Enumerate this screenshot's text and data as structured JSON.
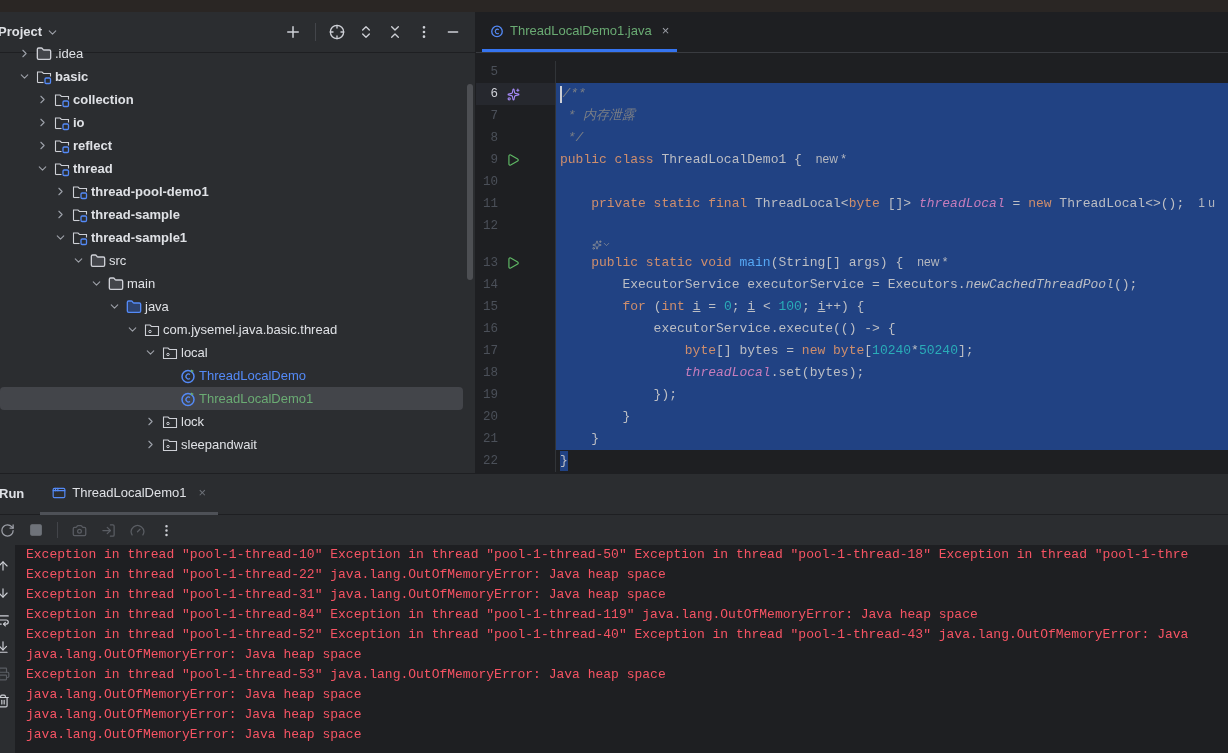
{
  "project_panel": {
    "title": "Project",
    "tree": [
      {
        "label": ".idea",
        "kind": "folder",
        "expanded": false,
        "selected": false
      },
      {
        "label": "basic",
        "kind": "module",
        "expanded": true,
        "selected": false,
        "children": [
          {
            "label": "collection",
            "kind": "module",
            "expanded": false,
            "selected": false
          },
          {
            "label": "io",
            "kind": "module",
            "expanded": false,
            "selected": false
          },
          {
            "label": "reflect",
            "kind": "module",
            "expanded": false,
            "selected": false
          },
          {
            "label": "thread",
            "kind": "module",
            "expanded": true,
            "selected": false,
            "children": [
              {
                "label": "thread-pool-demo1",
                "kind": "module",
                "expanded": false,
                "selected": false
              },
              {
                "label": "thread-sample",
                "kind": "module",
                "expanded": false,
                "selected": false
              },
              {
                "label": "thread-sample1",
                "kind": "module",
                "expanded": true,
                "selected": false,
                "children": [
                  {
                    "label": "src",
                    "kind": "folder",
                    "expanded": true,
                    "selected": false,
                    "children": [
                      {
                        "label": "main",
                        "kind": "folder",
                        "expanded": true,
                        "selected": false,
                        "children": [
                          {
                            "label": "java",
                            "kind": "source",
                            "expanded": true,
                            "selected": false,
                            "children": [
                              {
                                "label": "com.jysemel.java.basic.thread",
                                "kind": "package",
                                "expanded": true,
                                "selected": false,
                                "children": [
                                  {
                                    "label": "local",
                                    "kind": "package",
                                    "expanded": true,
                                    "selected": false,
                                    "children": [
                                      {
                                        "label": "ThreadLocalDemo",
                                        "kind": "class",
                                        "added": false,
                                        "selected": false
                                      },
                                      {
                                        "label": "ThreadLocalDemo1",
                                        "kind": "class",
                                        "added": true,
                                        "selected": true
                                      }
                                    ]
                                  },
                                  {
                                    "label": "lock",
                                    "kind": "package",
                                    "expanded": false,
                                    "selected": false
                                  },
                                  {
                                    "label": "sleepandwait",
                                    "kind": "package",
                                    "expanded": false,
                                    "selected": false
                                  }
                                ]
                              }
                            ]
                          }
                        ]
                      }
                    ]
                  }
                ]
              }
            ]
          }
        ]
      }
    ]
  },
  "editor": {
    "tabs": [
      {
        "label": "ThreadLocalDemo1.java",
        "added": true,
        "selected": true,
        "close": "×"
      }
    ],
    "lines": [
      {
        "kind": "code",
        "number": "5",
        "current": false,
        "selected": false
      },
      {
        "kind": "code",
        "number": "6",
        "current": true,
        "selected": true,
        "gutter": {
          "kind": "badge"
        },
        "tokens": [
          {
            "t": "/**",
            "kind": "comment"
          }
        ]
      },
      {
        "kind": "code",
        "number": "7",
        "current": false,
        "selected": true,
        "tokens": [
          {
            "t": " * 内存泄露",
            "kind": "comment"
          }
        ]
      },
      {
        "kind": "code",
        "number": "8",
        "current": false,
        "selected": true,
        "tokens": [
          {
            "t": " */",
            "kind": "comment"
          }
        ]
      },
      {
        "kind": "code",
        "number": "9",
        "current": false,
        "selected": true,
        "gutter": {
          "kind": "run"
        },
        "tokens": [
          {
            "t": "public class ",
            "kind": "keyword"
          },
          {
            "t": "ThreadLocalDemo1 {",
            "kind": "plain"
          },
          {
            "t": "new *",
            "kind": "hint"
          }
        ]
      },
      {
        "kind": "code",
        "number": "10",
        "current": false,
        "selected": true
      },
      {
        "kind": "code",
        "number": "11",
        "current": false,
        "selected": true,
        "tokens": [
          {
            "t": "    private static final ",
            "kind": "keyword"
          },
          {
            "t": "ThreadLocal<",
            "kind": "plain"
          },
          {
            "t": "byte ",
            "kind": "keyword"
          },
          {
            "t": "[]> ",
            "kind": "plain"
          },
          {
            "t": "threadLocal",
            "kind": "field"
          },
          {
            "t": " = ",
            "kind": "plain"
          },
          {
            "t": "new ",
            "kind": "keyword"
          },
          {
            "t": "ThreadLocal<>();",
            "kind": "plain"
          },
          {
            "t": "1 u",
            "kind": "hint"
          }
        ]
      },
      {
        "kind": "code",
        "number": "12",
        "current": false,
        "selected": true
      },
      {
        "kind": "inlay",
        "selected": true
      },
      {
        "kind": "code",
        "number": "13",
        "current": false,
        "selected": true,
        "gutter": {
          "kind": "run"
        },
        "tokens": [
          {
            "t": "    public static void ",
            "kind": "keyword"
          },
          {
            "t": "main",
            "kind": "method"
          },
          {
            "t": "(String[] args) {",
            "kind": "plain"
          },
          {
            "t": "new *",
            "kind": "hint"
          }
        ]
      },
      {
        "kind": "code",
        "number": "14",
        "current": false,
        "selected": true,
        "tokens": [
          {
            "t": "        ExecutorService executorService = Executors.",
            "kind": "plain"
          },
          {
            "t": "newCachedThreadPool",
            "kind": "static"
          },
          {
            "t": "();",
            "kind": "plain"
          }
        ]
      },
      {
        "kind": "code",
        "number": "15",
        "current": false,
        "selected": true,
        "tokens": [
          {
            "t": "        for ",
            "kind": "keyword"
          },
          {
            "t": "(",
            "kind": "plain"
          },
          {
            "t": "int ",
            "kind": "keyword"
          },
          {
            "t": "i",
            "kind": "variable"
          },
          {
            "t": " = ",
            "kind": "plain"
          },
          {
            "t": "0",
            "kind": "number"
          },
          {
            "t": "; ",
            "kind": "plain"
          },
          {
            "t": "i",
            "kind": "variable"
          },
          {
            "t": " < ",
            "kind": "plain"
          },
          {
            "t": "100",
            "kind": "number"
          },
          {
            "t": "; ",
            "kind": "plain"
          },
          {
            "t": "i",
            "kind": "variable"
          },
          {
            "t": "++) {",
            "kind": "plain"
          }
        ]
      },
      {
        "kind": "code",
        "number": "16",
        "current": false,
        "selected": true,
        "tokens": [
          {
            "t": "            executorService.execute(() -> {",
            "kind": "plain"
          }
        ]
      },
      {
        "kind": "code",
        "number": "17",
        "current": false,
        "selected": true,
        "tokens": [
          {
            "t": "                byte",
            "kind": "keyword"
          },
          {
            "t": "[] bytes = ",
            "kind": "plain"
          },
          {
            "t": "new byte",
            "kind": "keyword"
          },
          {
            "t": "[",
            "kind": "plain"
          },
          {
            "t": "10240",
            "kind": "number"
          },
          {
            "t": "*",
            "kind": "plain"
          },
          {
            "t": "50240",
            "kind": "number"
          },
          {
            "t": "];",
            "kind": "plain"
          }
        ]
      },
      {
        "kind": "code",
        "number": "18",
        "current": false,
        "selected": true,
        "tokens": [
          {
            "t": "                threadLocal",
            "kind": "field"
          },
          {
            "t": ".set(bytes);",
            "kind": "plain"
          }
        ]
      },
      {
        "kind": "code",
        "number": "19",
        "current": false,
        "selected": true,
        "tokens": [
          {
            "t": "            });",
            "kind": "plain"
          }
        ]
      },
      {
        "kind": "code",
        "number": "20",
        "current": false,
        "selected": true,
        "tokens": [
          {
            "t": "        }",
            "kind": "plain"
          }
        ]
      },
      {
        "kind": "code",
        "number": "21",
        "current": false,
        "selected": true,
        "tokens": [
          {
            "t": "    }",
            "kind": "plain"
          }
        ]
      },
      {
        "kind": "selection_end",
        "number": "22",
        "current": false,
        "selected": true,
        "tokens": [
          {
            "t": "}",
            "kind": "plain"
          }
        ]
      }
    ]
  },
  "run_panel": {
    "title": "Run",
    "tabs": [
      {
        "label": "ThreadLocalDemo1",
        "selected": true,
        "close": "×"
      }
    ],
    "console": [
      "Exception in thread \"pool-1-thread-10\" Exception in thread \"pool-1-thread-50\" Exception in thread \"pool-1-thread-18\" Exception in thread \"pool-1-thre",
      "Exception in thread \"pool-1-thread-22\" java.lang.OutOfMemoryError: Java heap space",
      "Exception in thread \"pool-1-thread-31\" java.lang.OutOfMemoryError: Java heap space",
      "Exception in thread \"pool-1-thread-84\" Exception in thread \"pool-1-thread-119\" java.lang.OutOfMemoryError: Java heap space",
      "Exception in thread \"pool-1-thread-52\" Exception in thread \"pool-1-thread-40\" Exception in thread \"pool-1-thread-43\" java.lang.OutOfMemoryError: Java",
      "java.lang.OutOfMemoryError: Java heap space",
      "Exception in thread \"pool-1-thread-53\" java.lang.OutOfMemoryError: Java heap space",
      "java.lang.OutOfMemoryError: Java heap space",
      "java.lang.OutOfMemoryError: Java heap space",
      "java.lang.OutOfMemoryError: Java heap space"
    ]
  }
}
